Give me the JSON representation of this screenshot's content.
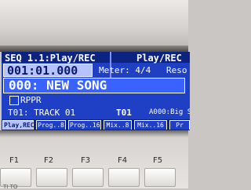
{
  "screen": {
    "title_left": "SEQ 1.1:Play/REC",
    "title_right": "Play/REC",
    "locator": "001:01.000",
    "meter": "Meter: 4/4",
    "reso": "Reso",
    "song": "000: NEW SONG",
    "rppr_label": "RPPR",
    "rppr_checked": false,
    "track": "T01: TRACK 01",
    "track_id": "T01",
    "program": "A000:Big Sc",
    "tabs": [
      {
        "label": "Play,REC",
        "active": true
      },
      {
        "label": "Prog..8",
        "active": false
      },
      {
        "label": "Prog..16",
        "active": false
      },
      {
        "label": "Mix..8",
        "active": false
      },
      {
        "label": "Mix..16",
        "active": false
      },
      {
        "label": "Pr",
        "active": false
      }
    ]
  },
  "function_keys": [
    {
      "label": "F1"
    },
    {
      "label": "F2"
    },
    {
      "label": "F3"
    },
    {
      "label": "F4"
    },
    {
      "label": "F5"
    }
  ],
  "bottom_sub_label": "TI TO",
  "colors": {
    "screen_bg": "#1f3fc4",
    "title_bar": "#0d2380",
    "highlight": "#b7c3ff",
    "text": "#ffffff"
  }
}
